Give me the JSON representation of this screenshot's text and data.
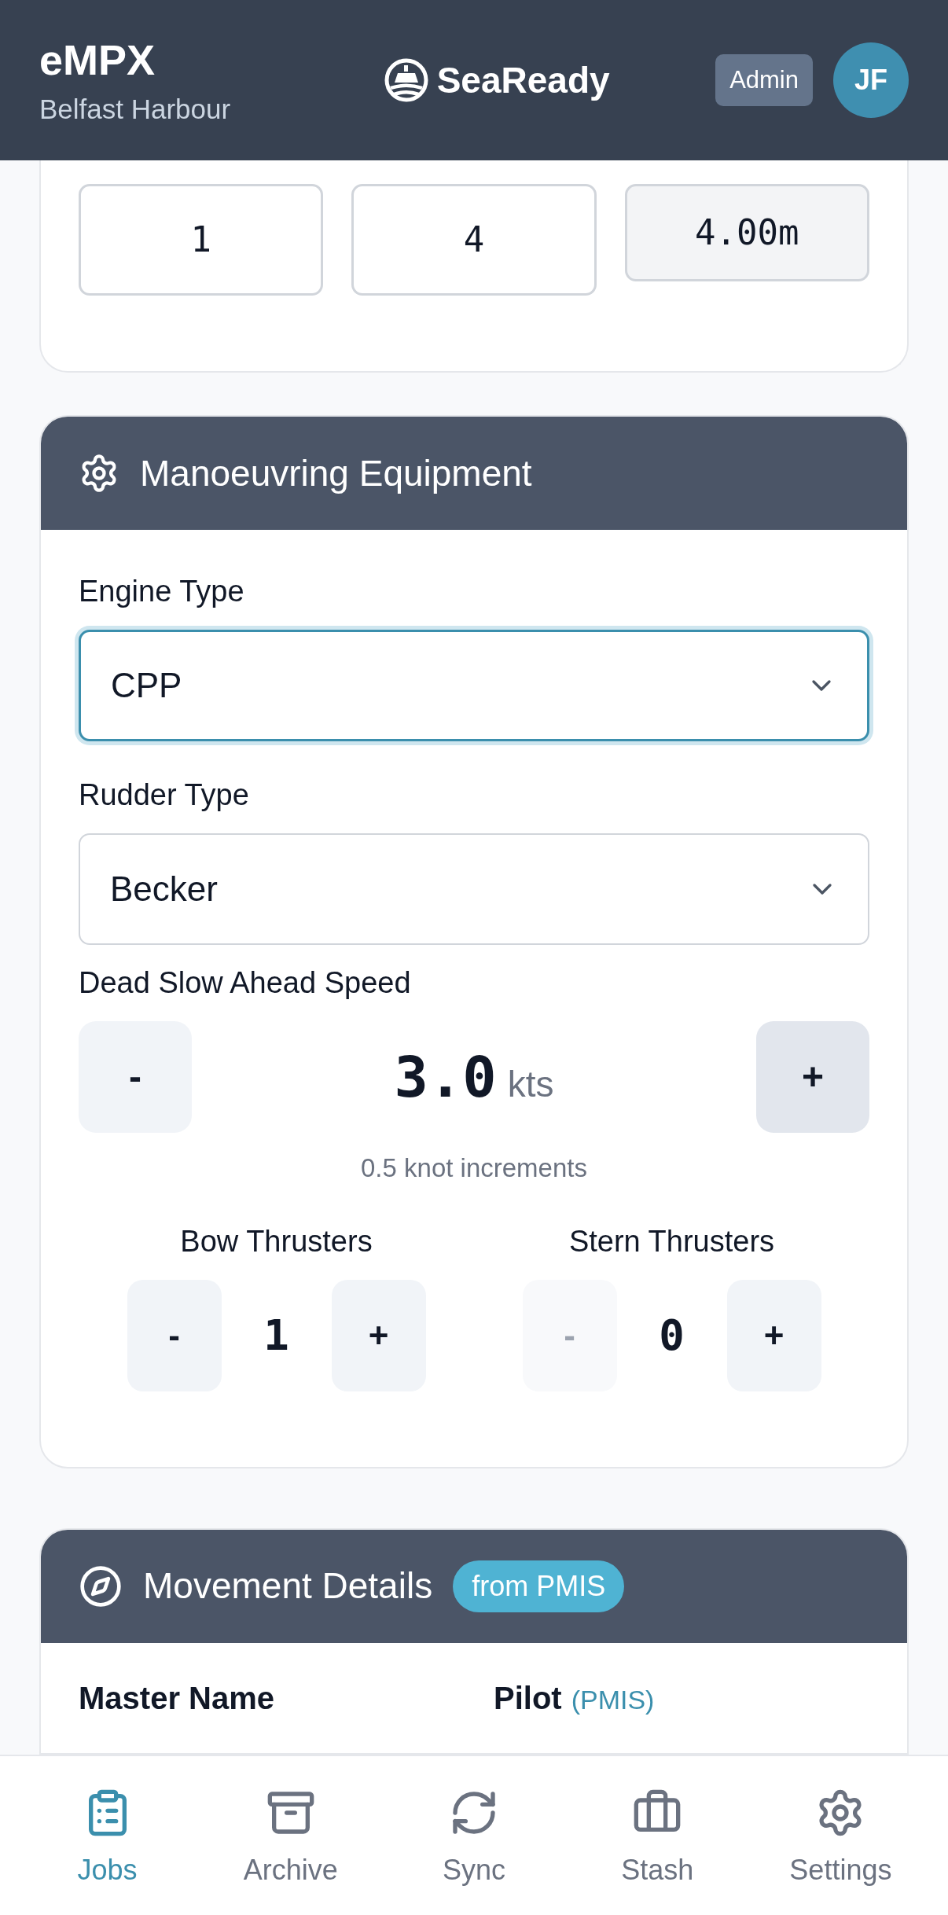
{
  "header": {
    "title": "eMPX",
    "subtitle": "Belfast Harbour",
    "brand": "SeaReady",
    "role_badge": "Admin",
    "avatar_initials": "JF"
  },
  "draft_card": {
    "fields": [
      {
        "value": "1",
        "kind": "input"
      },
      {
        "value": "4",
        "kind": "input"
      },
      {
        "value": "4.00m",
        "kind": "readonly"
      }
    ]
  },
  "manoeuvring": {
    "title": "Manoeuvring Equipment",
    "engine_type": {
      "label": "Engine Type",
      "value": "CPP",
      "focused": true
    },
    "rudder_type": {
      "label": "Rudder Type",
      "value": "Becker",
      "focused": false
    },
    "dead_slow": {
      "label": "Dead Slow Ahead Speed",
      "minus": "-",
      "value": "3.0",
      "unit": "kts",
      "plus": "+",
      "minus_pressed": false,
      "plus_pressed": true,
      "hint": "0.5 knot increments"
    },
    "thrusters": [
      {
        "label": "Bow Thrusters",
        "minus": "-",
        "value": "1",
        "plus": "+",
        "minus_disabled": false
      },
      {
        "label": "Stern Thrusters",
        "minus": "-",
        "value": "0",
        "plus": "+",
        "minus_disabled": true
      }
    ]
  },
  "movement": {
    "title": "Movement Details",
    "badge": "from PMIS",
    "fields": [
      {
        "label": "Master Name"
      },
      {
        "label": "Pilot",
        "tag": "(PMIS)"
      }
    ]
  },
  "bottom_nav": [
    {
      "label": "Jobs",
      "kind": "clipboard",
      "selected": true
    },
    {
      "label": "Archive",
      "kind": "archive",
      "selected": false
    },
    {
      "label": "Sync",
      "kind": "sync",
      "selected": false
    },
    {
      "label": "Stash",
      "kind": "briefcase",
      "selected": false
    },
    {
      "label": "Settings",
      "kind": "gear",
      "selected": false
    }
  ]
}
